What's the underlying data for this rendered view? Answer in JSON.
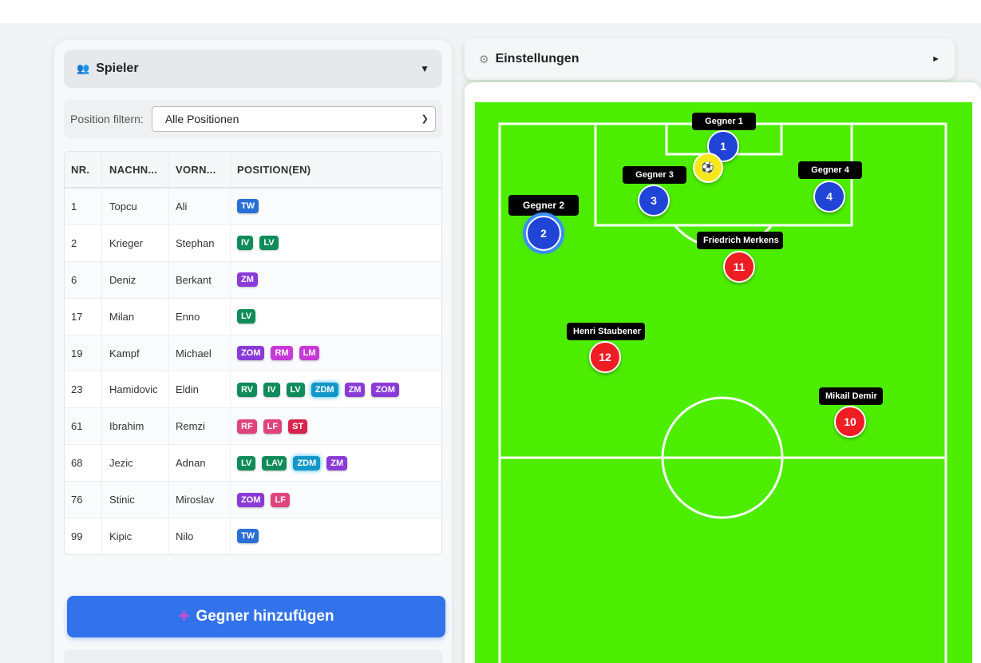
{
  "players_panel": {
    "icon": "people-icon",
    "title": "Spieler",
    "toggle_icon": "triangle-down-icon"
  },
  "filter": {
    "label": "Position filtern:",
    "selected": "Alle Positionen"
  },
  "table": {
    "headers": [
      "NR.",
      "NACHN...",
      "VORN...",
      "POSITION(EN)"
    ],
    "rows": [
      {
        "nr": "1",
        "last": "Topcu",
        "first": "Ali",
        "positions": [
          "TW"
        ]
      },
      {
        "nr": "2",
        "last": "Krieger",
        "first": "Stephan",
        "positions": [
          "IV",
          "LV"
        ]
      },
      {
        "nr": "6",
        "last": "Deniz",
        "first": "Berkant",
        "positions": [
          "ZM"
        ]
      },
      {
        "nr": "17",
        "last": "Milan",
        "first": "Enno",
        "positions": [
          "LV"
        ]
      },
      {
        "nr": "19",
        "last": "Kampf",
        "first": "Michael",
        "positions": [
          "ZOM",
          "RM",
          "LM"
        ]
      },
      {
        "nr": "23",
        "last": "Hamidovic",
        "first": "Eldin",
        "positions": [
          "RV",
          "IV",
          "LV",
          "ZDM",
          "ZM",
          "ZOM"
        ]
      },
      {
        "nr": "61",
        "last": "Ibrahim",
        "first": "Remzi",
        "positions": [
          "RF",
          "LF",
          "ST"
        ]
      },
      {
        "nr": "68",
        "last": "Jezic",
        "first": "Adnan",
        "positions": [
          "LV",
          "LAV",
          "ZDM",
          "ZM"
        ]
      },
      {
        "nr": "76",
        "last": "Stinic",
        "first": "Miroslav",
        "positions": [
          "ZOM",
          "LF"
        ]
      },
      {
        "nr": "99",
        "last": "Kipic",
        "first": "Nilo",
        "positions": [
          "TW"
        ]
      }
    ]
  },
  "add_opponent_button": {
    "icon": "plus-icon",
    "label": "Gegner hinzufügen"
  },
  "settings": {
    "icon": "gear-icon",
    "title": "Einstellungen",
    "toggle_icon": "triangle-right-icon"
  },
  "field": {
    "ball_icon": "soccer-ball-icon",
    "opponents": [
      {
        "number": "1",
        "name": "Gegner 1"
      },
      {
        "number": "2",
        "name": "Gegner 2"
      },
      {
        "number": "3",
        "name": "Gegner 3"
      },
      {
        "number": "4",
        "name": "Gegner 4"
      }
    ],
    "own_players": [
      {
        "number": "11",
        "name": "Friedrich Merkens"
      },
      {
        "number": "12",
        "name": "Henri Staubener"
      },
      {
        "number": "10",
        "name": "Mikail Demir"
      }
    ]
  },
  "colors": {
    "pitch": "#4ded00",
    "opponent": "#1f44d6",
    "own_player": "#ee1d24",
    "accent_button": "#3273ec"
  }
}
